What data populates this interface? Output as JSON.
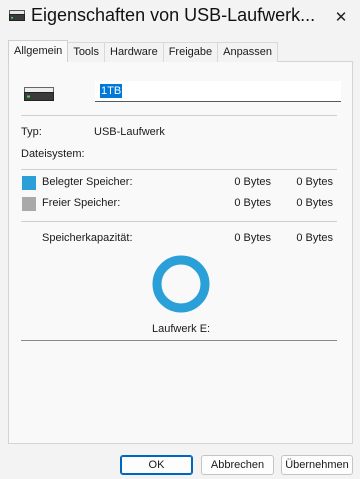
{
  "window": {
    "title": "Eigenschaften von USB-Laufwerk...",
    "close_glyph": "✕"
  },
  "tabs": [
    {
      "label": "Allgemein",
      "active": true
    },
    {
      "label": "Tools"
    },
    {
      "label": "Hardware"
    },
    {
      "label": "Freigabe"
    },
    {
      "label": "Anpassen"
    }
  ],
  "general": {
    "name_value": "1TB",
    "type_label": "Typ:",
    "type_value": "USB-Laufwerk",
    "fs_label": "Dateisystem:",
    "fs_value": "",
    "used_label": "Belegter Speicher:",
    "used_bytes": "0 Bytes",
    "used_size": "0 Bytes",
    "free_label": "Freier Speicher:",
    "free_bytes": "0 Bytes",
    "free_size": "0 Bytes",
    "capacity_label": "Speicherkapazität:",
    "capacity_bytes": "0 Bytes",
    "capacity_size": "0 Bytes",
    "drive_label": "Laufwerk E:"
  },
  "colors": {
    "used": "#2a9fd8",
    "free": "#a9a9a9",
    "accent": "#0078d7"
  },
  "icons": {
    "title": "drive-icon",
    "drive": "usb-drive-icon"
  },
  "buttons": {
    "ok": "OK",
    "cancel": "Abbrechen",
    "apply": "Übernehmen"
  }
}
